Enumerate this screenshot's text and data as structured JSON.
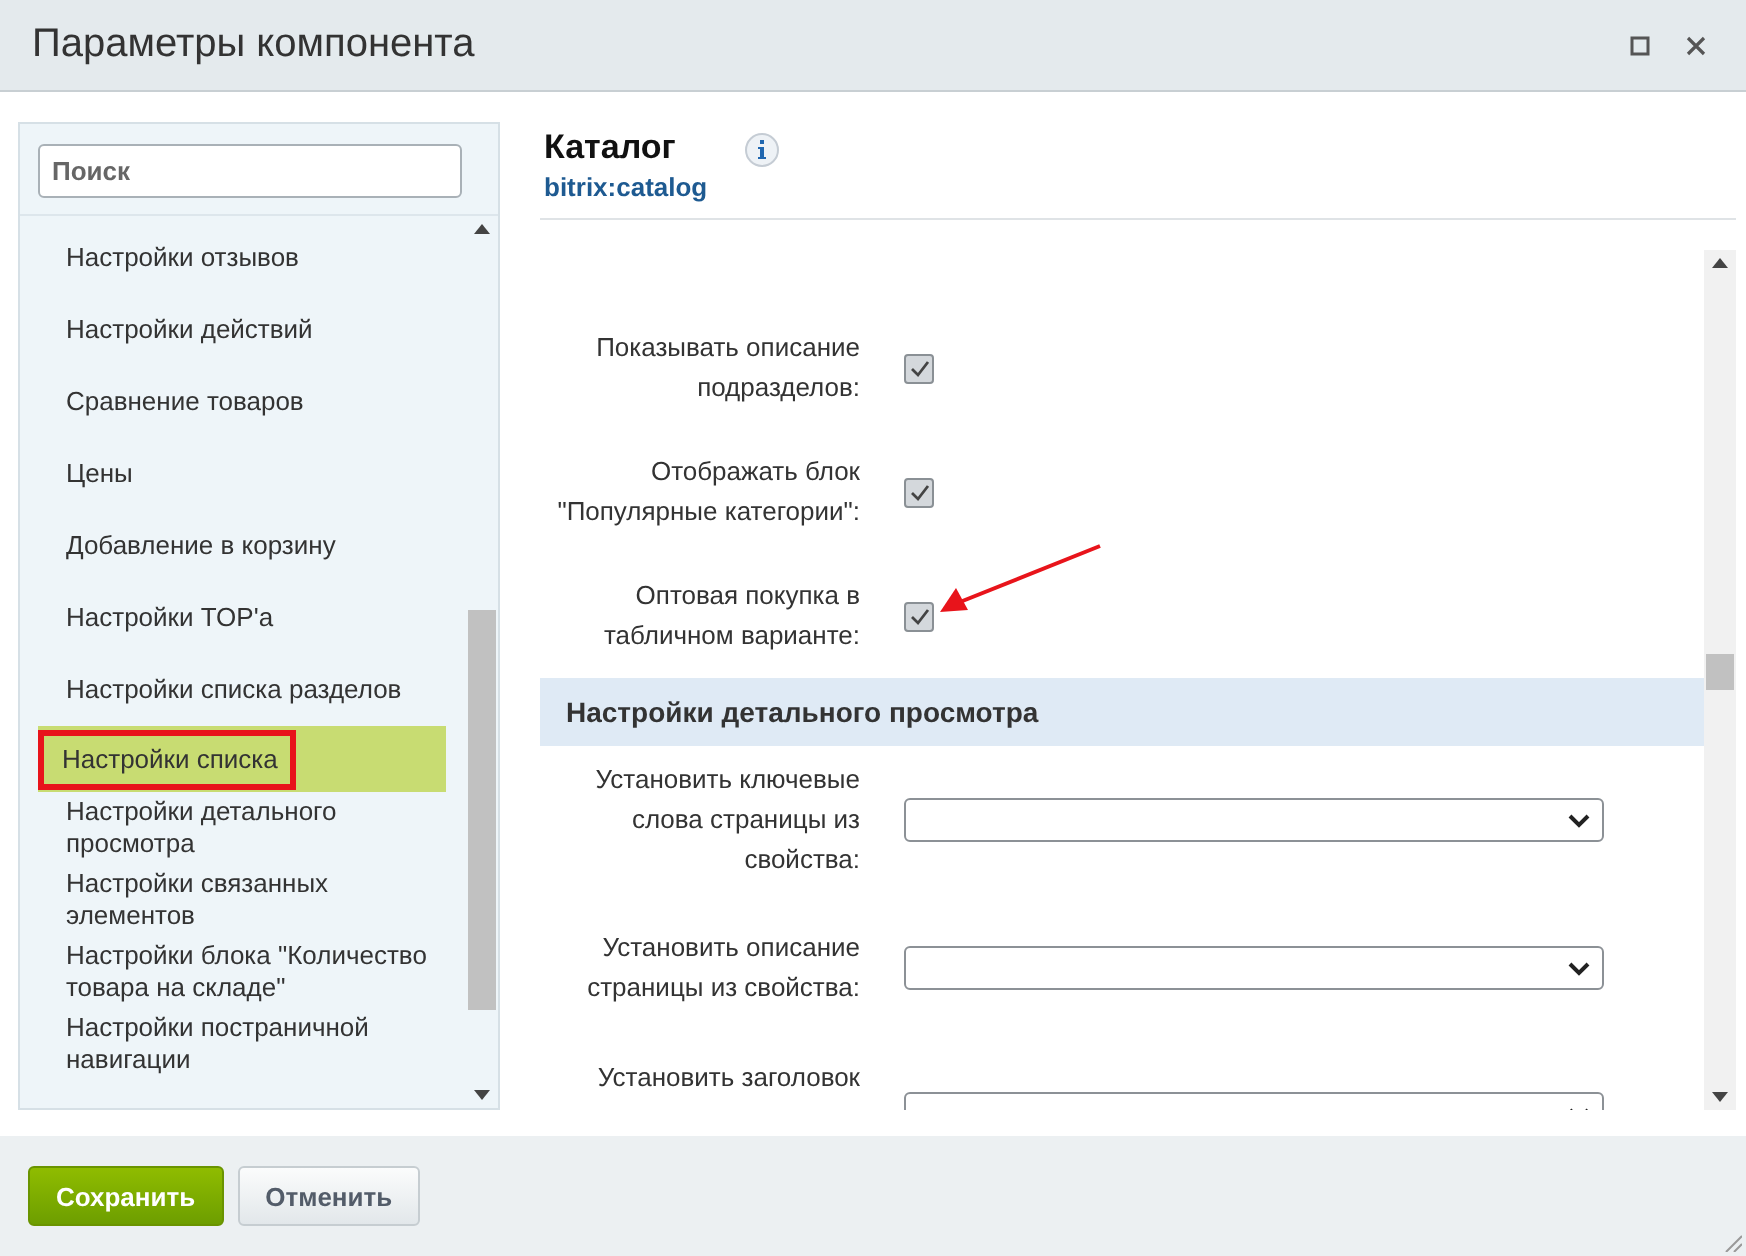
{
  "window": {
    "title": "Параметры компонента"
  },
  "sidebar": {
    "search": {
      "placeholder": "Поиск"
    },
    "items": [
      {
        "label": "Настройки отзывов",
        "selected": false,
        "annotated": false
      },
      {
        "label": "Настройки действий",
        "selected": false,
        "annotated": false
      },
      {
        "label": "Сравнение товаров",
        "selected": false,
        "annotated": false
      },
      {
        "label": "Цены",
        "selected": false,
        "annotated": false
      },
      {
        "label": "Добавление в корзину",
        "selected": false,
        "annotated": false
      },
      {
        "label": "Настройки TOP'а",
        "selected": false,
        "annotated": false
      },
      {
        "label": "Настройки списка разделов",
        "selected": false,
        "annotated": false
      },
      {
        "label": "Настройки списка",
        "selected": true,
        "annotated": true
      },
      {
        "label": "Настройки детального просмотра",
        "selected": false,
        "annotated": false
      },
      {
        "label": "Настройки связанных элементов",
        "selected": false,
        "annotated": false
      },
      {
        "label": "Настройки блока \"Количество товара на складе\"",
        "selected": false,
        "annotated": false
      },
      {
        "label": "Настройки постраничной навигации",
        "selected": false,
        "annotated": false
      }
    ]
  },
  "component": {
    "name": "Каталог",
    "code": "bitrix:catalog"
  },
  "settings": [
    {
      "kind": "checkbox",
      "label": "Показывать описание подразделов:",
      "checked": true,
      "annotated": false
    },
    {
      "kind": "checkbox",
      "label": "Отображать блок \"Популярные категории\":",
      "checked": true,
      "annotated": false
    },
    {
      "kind": "checkbox",
      "label": "Оптовая покупка в табличном варианте:",
      "checked": true,
      "annotated": true
    },
    {
      "kind": "section",
      "label": "Настройки детального просмотра"
    },
    {
      "kind": "select",
      "label": "Установить ключевые слова страницы из свойства:"
    },
    {
      "kind": "select",
      "label": "Установить описание страницы из свойства:"
    },
    {
      "kind": "select",
      "label": "Установить заголовок"
    }
  ],
  "buttons": [
    {
      "label": "Сохранить",
      "kind": "primary"
    },
    {
      "label": "Отменить",
      "kind": "secondary"
    }
  ]
}
